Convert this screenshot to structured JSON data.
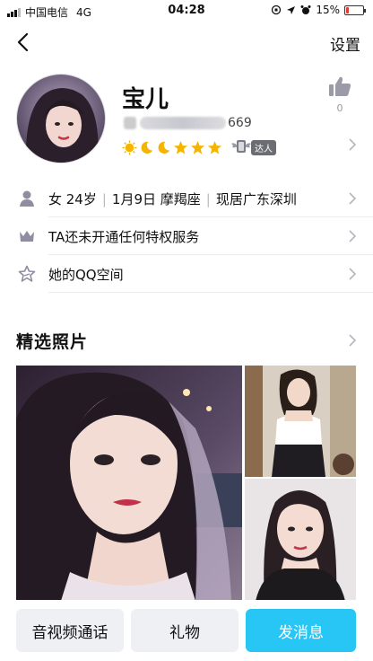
{
  "status_bar": {
    "carrier": "中国电信",
    "network": "4G",
    "time": "04:28",
    "battery": "15%",
    "battery_level": 0.15,
    "battery_color": "#e53935"
  },
  "nav": {
    "back_icon": "chevron-left-icon",
    "settings_label": "设置"
  },
  "profile": {
    "name": "宝儿",
    "uid_visible": "669",
    "badge_label": "达人",
    "level_icons": [
      "sun",
      "moon",
      "moon",
      "star",
      "star",
      "star"
    ],
    "like_count": "0"
  },
  "rows": [
    {
      "icon": "person-icon",
      "parts": [
        "女 24岁",
        "1月9日 摩羯座",
        "现居广东深圳"
      ]
    },
    {
      "icon": "crown-icon",
      "label": "TA还未开通任何特权服务"
    },
    {
      "icon": "qzone-star-icon",
      "label": "她的QQ空间"
    }
  ],
  "photos": {
    "section_title": "精选照片"
  },
  "bottom_actions": {
    "video_call": "音视频通话",
    "gift": "礼物",
    "message": "发消息"
  },
  "colors": {
    "accent": "#28c6f4",
    "button_gray": "#eef0f4",
    "icon_gray": "#8e8ea0",
    "level_gold": "#f5b400"
  }
}
